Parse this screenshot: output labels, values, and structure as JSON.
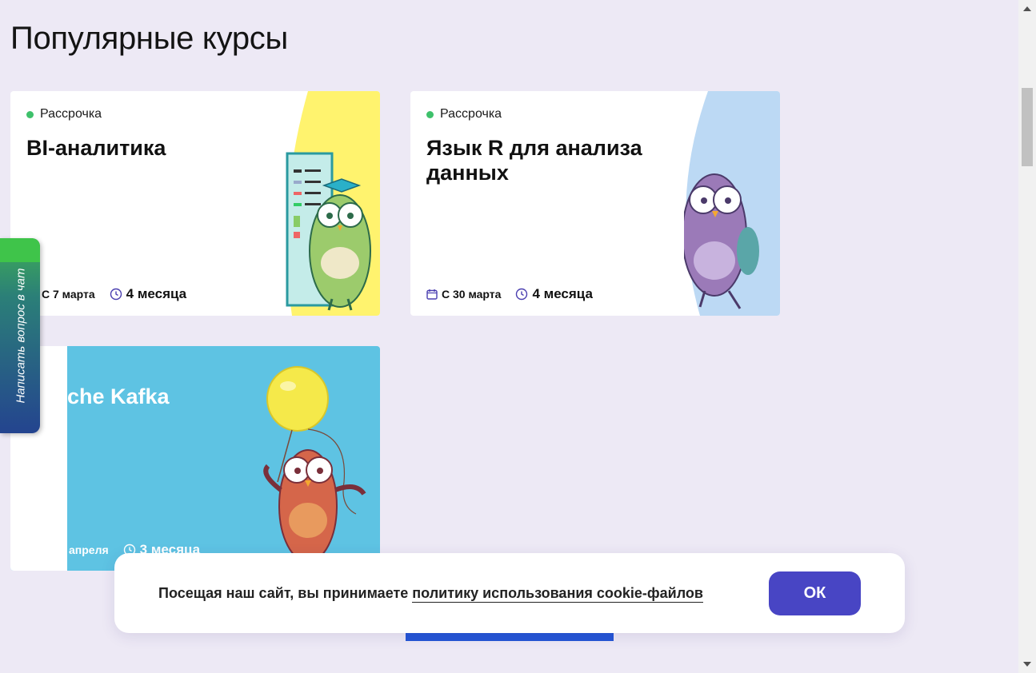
{
  "page": {
    "title": "Популярные курсы"
  },
  "courses": [
    {
      "tag": "Рассрочка",
      "title": "BI-аналитика",
      "start": "С 7 марта",
      "duration": "4 месяца",
      "art_color": "#fff36e"
    },
    {
      "tag": "Рассрочка",
      "title": "Язык R для анализа данных",
      "start": "С 30 марта",
      "duration": "4 месяца",
      "art_color": "#bcd9f4"
    },
    {
      "title": "che Kafka",
      "start": "апреля",
      "duration": "3 месяца",
      "art_color": "#5ec3e3"
    }
  ],
  "chat": {
    "label": "Написать вопрос в чат"
  },
  "cookie": {
    "text": "Посещая наш сайт, вы принимаете ",
    "link": "политику использования cookie-файлов",
    "ok": "ОК"
  },
  "icons": {
    "status": "dot-icon",
    "calendar": "calendar-icon",
    "clock": "clock-icon"
  }
}
